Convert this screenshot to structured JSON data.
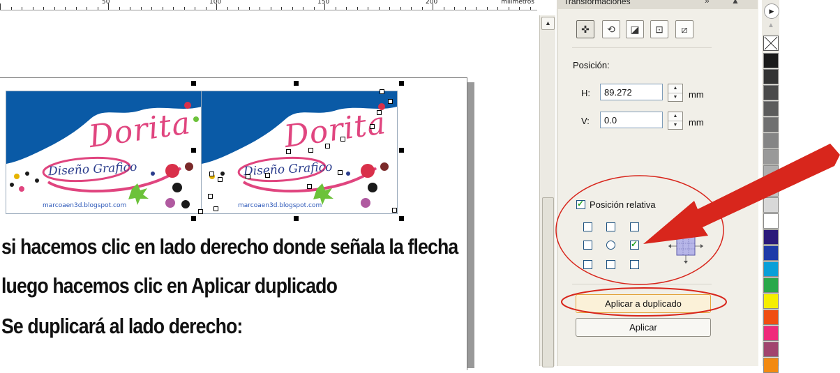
{
  "ruler": {
    "ticks": [
      "50",
      "100",
      "150",
      "200"
    ],
    "units": "milímetros"
  },
  "cards": [
    {
      "script_text": "Dorita",
      "subtitle": "Diseño Grafico",
      "blog": "marcoaen3d.blogspot.com"
    },
    {
      "script_text": "Dorita",
      "subtitle": "Diseño Grafico",
      "blog": "marcoaen3d.blogspot.com"
    }
  ],
  "instructions": [
    "si hacemos clic en lado derecho donde señala la flecha",
    "luego hacemos clic en Aplicar duplicado",
    "Se duplicará al lado derecho:"
  ],
  "docker": {
    "title": "Transformaciones",
    "controls": "» ▲ ✕",
    "tool_buttons": [
      {
        "icon": "position-icon",
        "glyph": "✜"
      },
      {
        "icon": "rotate-icon",
        "glyph": "⟲"
      },
      {
        "icon": "scale-mirror-icon",
        "glyph": "◪"
      },
      {
        "icon": "size-icon",
        "glyph": "⊡"
      },
      {
        "icon": "skew-icon",
        "glyph": "⧄"
      }
    ],
    "position_label": "Posición:",
    "h_label": "H:",
    "h_value": "89.272",
    "v_label": "V:",
    "v_value": "0.0",
    "unit": "mm",
    "relative_label": "Posición relativa",
    "relative_checked": true,
    "anchor_selected": "middle-right",
    "apply_duplicate_label": "Aplicar a duplicado",
    "apply_label": "Aplicar"
  },
  "palette": {
    "scroll_top": "▶",
    "scroll_up": "▲",
    "colors": [
      "#1a1a1a",
      "#333333",
      "#4a4a4a",
      "#5c5c5c",
      "#707070",
      "#858585",
      "#999999",
      "#aeaeae",
      "#c3c3c3",
      "#d8d8d8",
      "#ffffff",
      "#2b1a7a",
      "#1e3aa8",
      "#0a9fd8",
      "#2aa84a",
      "#f5ee00",
      "#f04e12",
      "#ef2a7b",
      "#a1446e",
      "#f28a12"
    ]
  },
  "annotation_colors": {
    "arrow": "#d8261c",
    "ellipse": "#d8261c"
  }
}
